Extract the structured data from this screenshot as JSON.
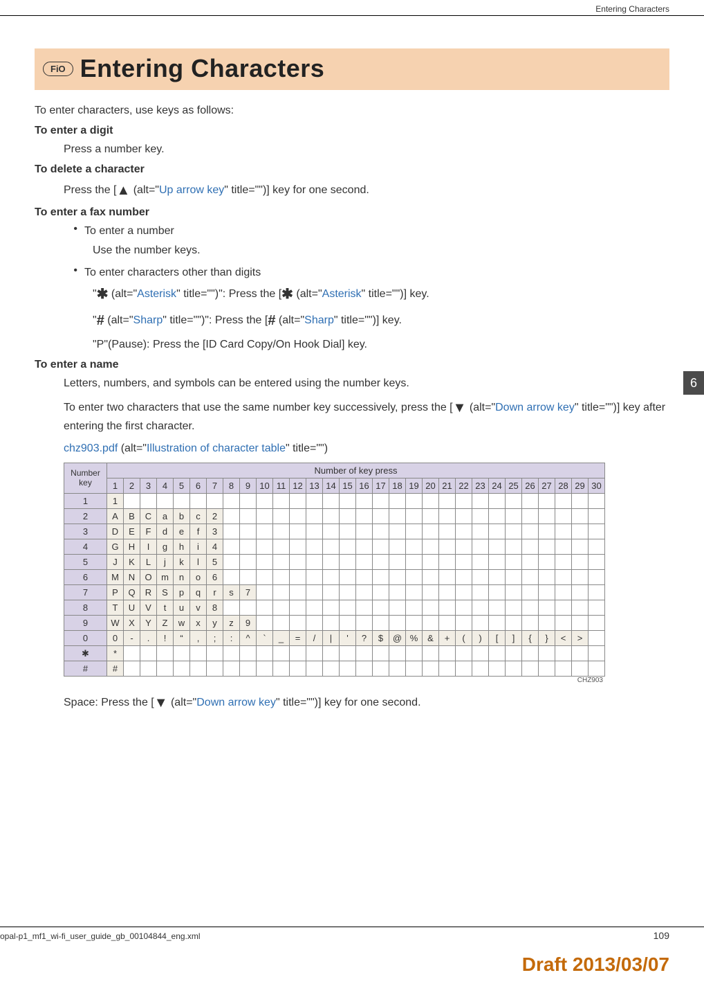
{
  "header": {
    "section": "Entering Characters"
  },
  "side_tab": "6",
  "title": {
    "fio": "FiO",
    "heading": "Entering Characters"
  },
  "intro": "To enter characters, use keys as follows:",
  "s_digit": {
    "h": "To enter a digit",
    "p": "Press a number key."
  },
  "s_delete": {
    "h": "To delete a character",
    "pre": "Press the [",
    "glyph": "▲",
    "alt_open": " (alt=\"",
    "alt_link": "Up arrow key",
    "alt_close": "\" title=\"\")] key for one second."
  },
  "s_fax": {
    "h": "To enter a fax number",
    "b1_label": "To enter a number",
    "b1_body": "Use the number keys.",
    "b2_label": "To enter characters other than digits",
    "l_ast": {
      "q1": "\"",
      "g": "✱",
      "alt1a": " (alt=\"",
      "alt1l": "Asterisk",
      "alt1b": "\" title=\"\")\": Press the [",
      "g2": "✱",
      "alt2a": " (alt=\"",
      "alt2l": "Asterisk",
      "alt2b": "\" title=\"\")] key."
    },
    "l_sh": {
      "q1": "\"",
      "g": "#",
      "alt1a": " (alt=\"",
      "alt1l": "Sharp",
      "alt1b": "\" title=\"\")\": Press the [",
      "g2": "#",
      "alt2a": " (alt=\"",
      "alt2l": "Sharp",
      "alt2b": "\" title=\"\")] key."
    },
    "l_pause": "\"P\"(Pause): Press the [ID Card Copy/On Hook Dial] key."
  },
  "s_name": {
    "h": "To enter a name",
    "p1": "Letters, numbers, and symbols can be entered using the number keys.",
    "p2a": "To enter two characters that use the same number key successively, press the [",
    "p2g": "▼",
    "p2b": " (alt=\"",
    "p2l": "Down arrow key",
    "p2c": "\" title=\"\")] key after entering the first character.",
    "img_file": "chz903.pdf",
    "img_alt_a": " (alt=\"",
    "img_alt_l": "Illustration of character table",
    "img_alt_b": "\" title=\"\")"
  },
  "table": {
    "corner_l1": "Number",
    "corner_l2": "key",
    "super": "Number of key press",
    "cols": [
      "1",
      "2",
      "3",
      "4",
      "5",
      "6",
      "7",
      "8",
      "9",
      "10",
      "11",
      "12",
      "13",
      "14",
      "15",
      "16",
      "17",
      "18",
      "19",
      "20",
      "21",
      "22",
      "23",
      "24",
      "25",
      "26",
      "27",
      "28",
      "29",
      "30"
    ],
    "rows": [
      {
        "k": "1",
        "c": [
          "1"
        ]
      },
      {
        "k": "2",
        "c": [
          "A",
          "B",
          "C",
          "a",
          "b",
          "c",
          "2"
        ]
      },
      {
        "k": "3",
        "c": [
          "D",
          "E",
          "F",
          "d",
          "e",
          "f",
          "3"
        ]
      },
      {
        "k": "4",
        "c": [
          "G",
          "H",
          "I",
          "g",
          "h",
          "i",
          "4"
        ]
      },
      {
        "k": "5",
        "c": [
          "J",
          "K",
          "L",
          "j",
          "k",
          "l",
          "5"
        ]
      },
      {
        "k": "6",
        "c": [
          "M",
          "N",
          "O",
          "m",
          "n",
          "o",
          "6"
        ]
      },
      {
        "k": "7",
        "c": [
          "P",
          "Q",
          "R",
          "S",
          "p",
          "q",
          "r",
          "s",
          "7"
        ]
      },
      {
        "k": "8",
        "c": [
          "T",
          "U",
          "V",
          "t",
          "u",
          "v",
          "8"
        ]
      },
      {
        "k": "9",
        "c": [
          "W",
          "X",
          "Y",
          "Z",
          "w",
          "x",
          "y",
          "z",
          "9"
        ]
      },
      {
        "k": "0",
        "c": [
          "0",
          "-",
          ".",
          "!",
          "“",
          ",",
          ";",
          ":",
          "^",
          "`",
          "_",
          "=",
          "/",
          "|",
          "'",
          "?",
          "$",
          "@",
          "%",
          "&",
          "+",
          "(",
          ")",
          "[",
          "]",
          "{",
          "}",
          "<",
          ">"
        ]
      },
      {
        "k": "✱",
        "c": [
          "*"
        ]
      },
      {
        "k": "#",
        "c": [
          "#"
        ]
      }
    ],
    "caption": "CHZ903"
  },
  "space": {
    "pre": "Space: Press the [",
    "g": "▼",
    "a": " (alt=\"",
    "l": "Down arrow key",
    "b": "\" title=\"\")] key for one second."
  },
  "footer": {
    "file": "opal-p1_mf1_wi-fi_user_guide_gb_00104844_eng.xml",
    "page": "109",
    "draft": "Draft 2013/03/07"
  }
}
